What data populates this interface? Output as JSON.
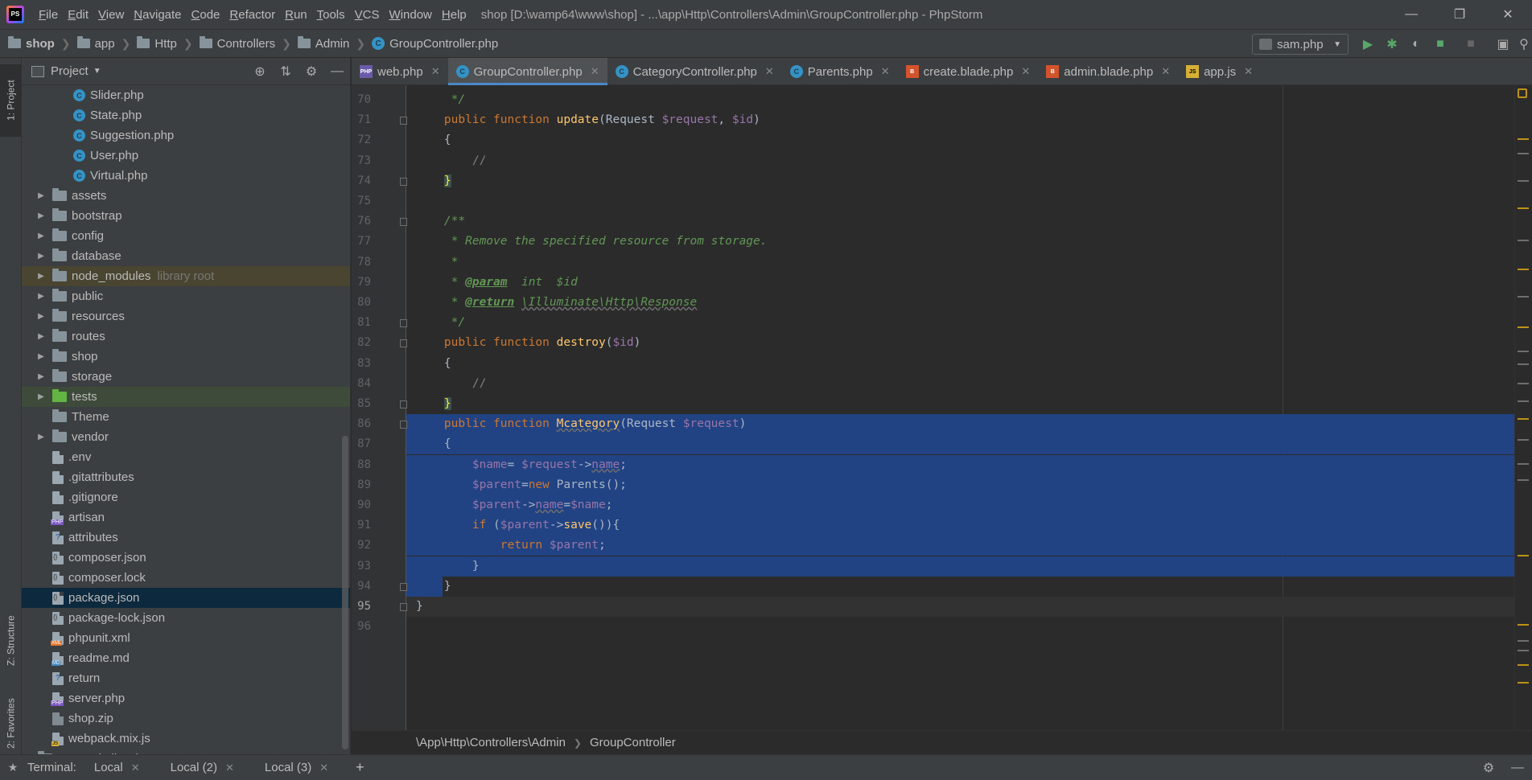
{
  "window": {
    "title": "shop [D:\\wamp64\\www\\shop] - ...\\app\\Http\\Controllers\\Admin\\GroupController.php - PhpStorm",
    "menu": [
      "File",
      "Edit",
      "View",
      "Navigate",
      "Code",
      "Refactor",
      "Run",
      "Tools",
      "VCS",
      "Window",
      "Help"
    ]
  },
  "breadcrumb": [
    "shop",
    "app",
    "Http",
    "Controllers",
    "Admin",
    "GroupController.php"
  ],
  "run_config": "sam.php",
  "left_strip": {
    "project": "1: Project",
    "structure": "Z: Structure",
    "favorites": "2: Favorites"
  },
  "project_panel": {
    "title": "Project",
    "tree": [
      {
        "name": "Slider.php",
        "type": "class",
        "indent": 1
      },
      {
        "name": "State.php",
        "type": "class",
        "indent": 1
      },
      {
        "name": "Suggestion.php",
        "type": "class",
        "indent": 1
      },
      {
        "name": "User.php",
        "type": "class",
        "indent": 1
      },
      {
        "name": "Virtual.php",
        "type": "class",
        "indent": 1
      },
      {
        "name": "assets",
        "type": "folder"
      },
      {
        "name": "bootstrap",
        "type": "folder"
      },
      {
        "name": "config",
        "type": "folder"
      },
      {
        "name": "database",
        "type": "folder"
      },
      {
        "name": "node_modules",
        "type": "folder",
        "note": "library root",
        "style": "highlight"
      },
      {
        "name": "public",
        "type": "folder"
      },
      {
        "name": "resources",
        "type": "folder"
      },
      {
        "name": "routes",
        "type": "folder"
      },
      {
        "name": "shop",
        "type": "folder"
      },
      {
        "name": "storage",
        "type": "folder"
      },
      {
        "name": "tests",
        "type": "folder-green",
        "style": "green"
      },
      {
        "name": "Theme",
        "type": "folder",
        "noarrow": true
      },
      {
        "name": "vendor",
        "type": "folder"
      },
      {
        "name": ".env",
        "type": "file"
      },
      {
        "name": ".gitattributes",
        "type": "file"
      },
      {
        "name": ".gitignore",
        "type": "file"
      },
      {
        "name": "artisan",
        "type": "php"
      },
      {
        "name": "attributes",
        "type": "unknown"
      },
      {
        "name": "composer.json",
        "type": "json"
      },
      {
        "name": "composer.lock",
        "type": "json"
      },
      {
        "name": "package.json",
        "type": "json",
        "style": "selected"
      },
      {
        "name": "package-lock.json",
        "type": "json"
      },
      {
        "name": "phpunit.xml",
        "type": "xml"
      },
      {
        "name": "readme.md",
        "type": "md"
      },
      {
        "name": "return",
        "type": "unknown"
      },
      {
        "name": "server.php",
        "type": "php"
      },
      {
        "name": "shop.zip",
        "type": "zip"
      },
      {
        "name": "webpack.mix.js",
        "type": "js"
      },
      {
        "name": "External Libraries",
        "type": "lib",
        "indent": -1
      }
    ]
  },
  "tabs": [
    {
      "label": "web.php",
      "icon": "php"
    },
    {
      "label": "GroupController.php",
      "icon": "cls",
      "active": true
    },
    {
      "label": "CategoryController.php",
      "icon": "cls"
    },
    {
      "label": "Parents.php",
      "icon": "cls"
    },
    {
      "label": "create.blade.php",
      "icon": "blade"
    },
    {
      "label": "admin.blade.php",
      "icon": "blade"
    },
    {
      "label": "app.js",
      "icon": "js"
    }
  ],
  "code": {
    "lines": [
      {
        "n": "70",
        "html": "<span class=\"doc\">     */</span>"
      },
      {
        "n": "71",
        "html": "    <span class=\"kw\">public function </span><span class=\"fn\">update</span>(Request <span class=\"var\">$request</span>, <span class=\"var\">$id</span>)"
      },
      {
        "n": "72",
        "html": "    {"
      },
      {
        "n": "73",
        "html": "        <span class=\"cmt\">//</span>"
      },
      {
        "n": "74",
        "html": "    <span class=\"brace-hl\">}</span>"
      },
      {
        "n": "75",
        "html": ""
      },
      {
        "n": "76",
        "html": "    <span class=\"doc\">/**</span>"
      },
      {
        "n": "77",
        "html": "<span class=\"doc\">     * Remove the specified resource from storage.</span>"
      },
      {
        "n": "78",
        "html": "<span class=\"doc\">     *</span>"
      },
      {
        "n": "79",
        "html": "<span class=\"doc\">     * </span><span class=\"doctag\">@param</span><span class=\"doc\">  int  $id</span>"
      },
      {
        "n": "80",
        "html": "<span class=\"doc\">     * </span><span class=\"doctag\">@return</span><span class=\"doc\"> </span><span class=\"doc wavy\">\\Illuminate\\Http\\Response</span>"
      },
      {
        "n": "81",
        "html": "<span class=\"doc\">     */</span>"
      },
      {
        "n": "82",
        "html": "    <span class=\"kw\">public function </span><span class=\"fn\">destroy</span>(<span class=\"var\">$id</span>)"
      },
      {
        "n": "83",
        "html": "    {"
      },
      {
        "n": "84",
        "html": "        <span class=\"cmt\">//</span>"
      },
      {
        "n": "85",
        "html": "    <span class=\"brace-hl\">}</span>"
      },
      {
        "n": "86",
        "html": "    <span class=\"kw\">public function </span><span class=\"fn wavy\">Mcategory</span>(Request <span class=\"var\">$request</span>)",
        "sel": true
      },
      {
        "n": "87",
        "html": "    {",
        "sel": true
      },
      {
        "n": "88",
        "html": "        <span class=\"var\">$name</span>= <span class=\"var\">$request</span>-><span class=\"var wavy\">name</span>;",
        "sel": true
      },
      {
        "n": "89",
        "html": "        <span class=\"var\">$parent</span>=<span class=\"kw\">new </span>Parents();",
        "sel": true
      },
      {
        "n": "90",
        "html": "        <span class=\"var\">$parent</span>-><span class=\"var wavy\">name</span>=<span class=\"var\">$name</span>;",
        "sel": true
      },
      {
        "n": "91",
        "html": "        <span class=\"kw\">if </span>(<span class=\"var\">$parent</span>-><span class=\"fn\">save</span>()){",
        "sel": true
      },
      {
        "n": "92",
        "html": "            <span class=\"kw\">return </span><span class=\"var\">$parent</span>;",
        "sel": true
      },
      {
        "n": "93",
        "html": "        }",
        "sel": true
      },
      {
        "n": "94",
        "html": "    }",
        "sel": "partial"
      },
      {
        "n": "95",
        "html": "}",
        "current": true
      },
      {
        "n": "96",
        "html": ""
      }
    ]
  },
  "editor_breadcrumb": [
    "\\App\\Http\\Controllers\\Admin",
    "GroupController"
  ],
  "terminal": {
    "label": "Terminal:",
    "tabs": [
      "Local",
      "Local (2)",
      "Local (3)"
    ],
    "add": "+"
  },
  "colors": {
    "accent": "#4a88c7",
    "selection": "#214283",
    "background": "#2b2b2b",
    "panel": "#3c3f41"
  }
}
